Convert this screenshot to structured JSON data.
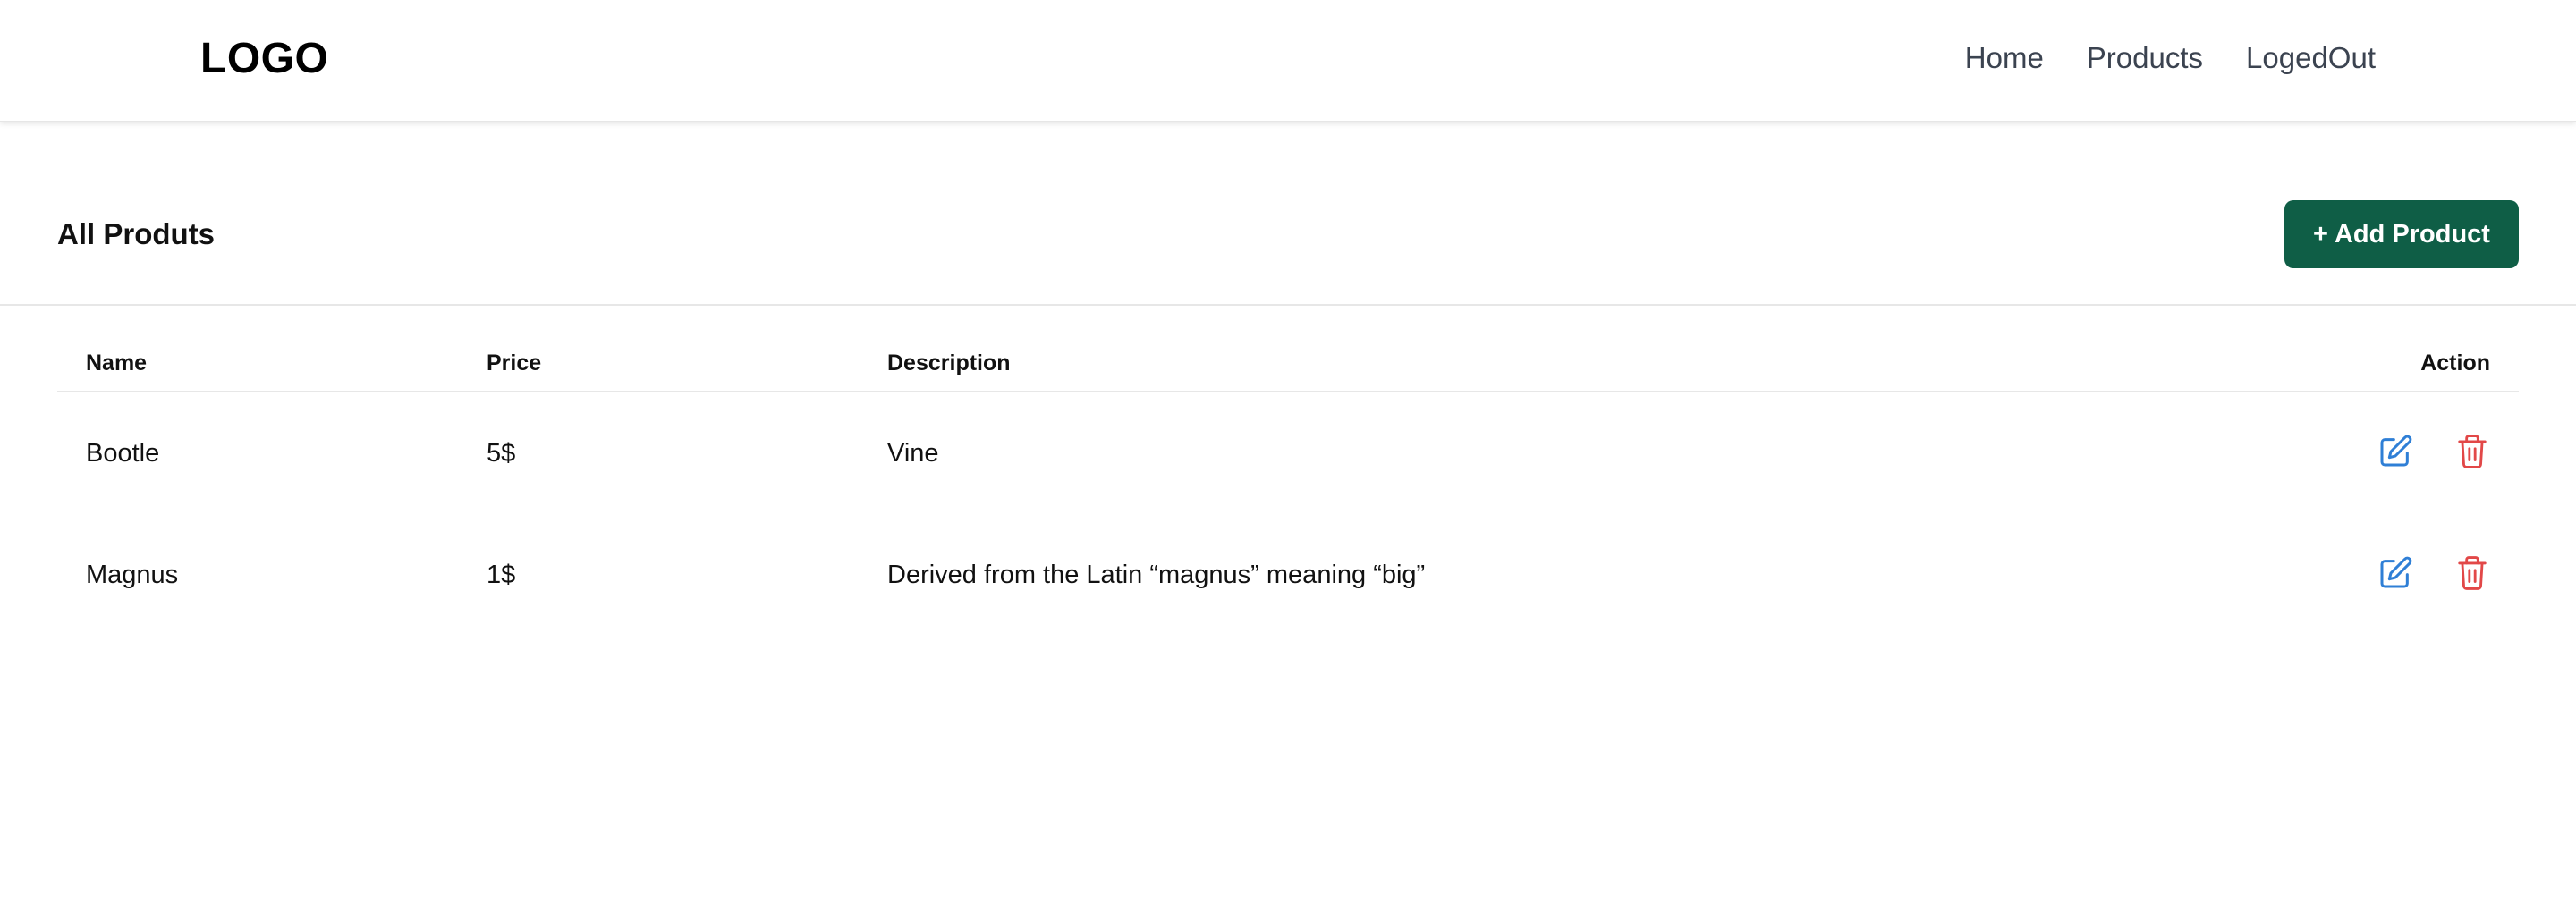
{
  "header": {
    "logo": "LOGO",
    "nav": [
      "Home",
      "Products",
      "LogedOut"
    ]
  },
  "page": {
    "title": "All Produts",
    "add_button_label": "+ Add Product"
  },
  "table": {
    "columns": [
      "Name",
      "Price",
      "Description",
      "Action"
    ],
    "rows": [
      {
        "name": "Bootle",
        "price": "5$",
        "description": "Vine"
      },
      {
        "name": "Magnus",
        "price": "1$",
        "description": "Derived from the Latin “magnus” meaning “big”"
      }
    ]
  },
  "colors": {
    "primary": "#0f5e46",
    "edit": "#2f7fd6",
    "delete": "#e24848",
    "nav_text": "#3b4350"
  },
  "icons": {
    "edit": "edit-icon",
    "delete": "trash-icon"
  }
}
